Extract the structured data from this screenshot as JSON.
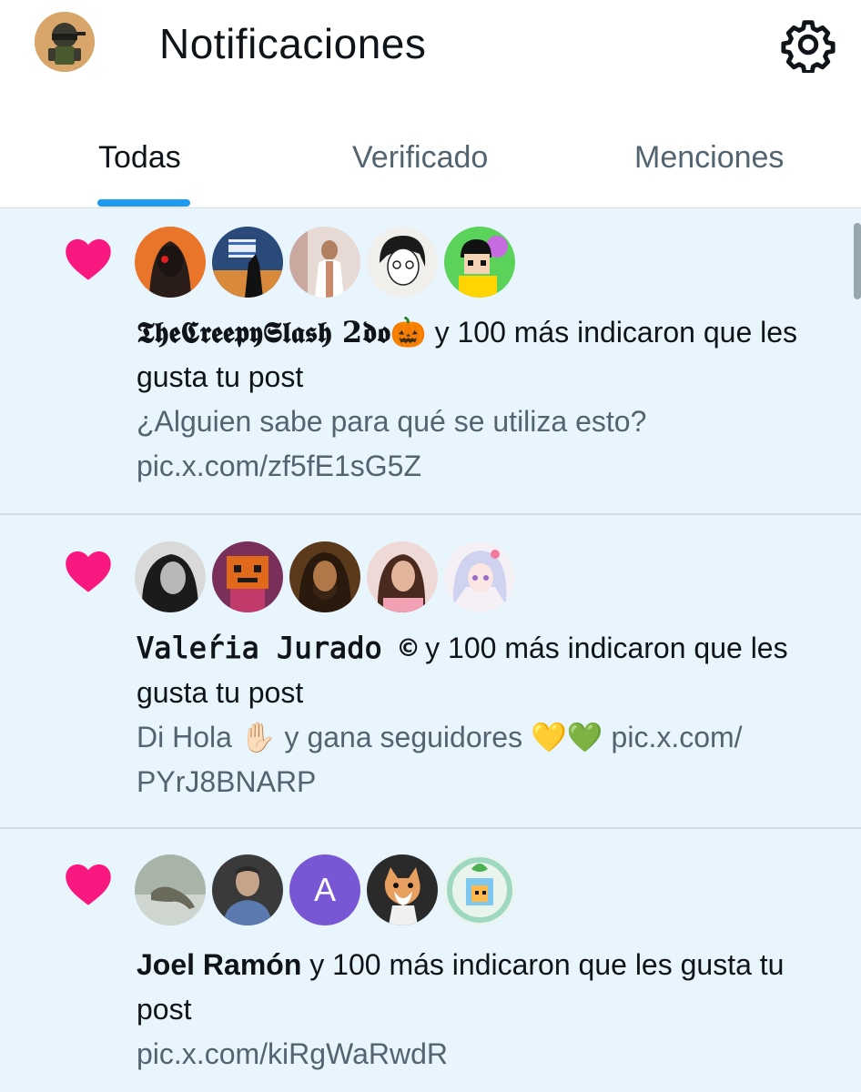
{
  "header": {
    "title": "Notificaciones"
  },
  "tabs": [
    {
      "label": "Todas",
      "active": true
    },
    {
      "label": "Verificado",
      "active": false
    },
    {
      "label": "Menciones",
      "active": false
    }
  ],
  "notifications": [
    {
      "type": "like",
      "user": "𝕿𝖍𝖊𝕮𝖗𝖊𝖊𝖕𝖞𝕾𝖑𝖆𝖘𝖍 𝟐𝖉𝖔🎃",
      "action": " y 100 más indicaron que les gusta tu post",
      "post_text": "¿Alguien sabe para qué se utiliza esto? pic.x.com/zf5fE1sG5Z"
    },
    {
      "type": "like",
      "user": "𝚅𝚊𝚕𝚎́𝚛𝚒𝚊 𝙹𝚞𝚛𝚊𝚍𝚘 ©",
      "action": " y 100 más indicaron que les gusta tu post",
      "post_text": "Di Hola ✋🏻 y gana seguidores 💛💚 pic.x.com/ PYrJ8BNARP"
    },
    {
      "type": "like",
      "user": "Joel Ramón",
      "action": " y 100 más indicaron que les gusta tu post",
      "post_text": "pic.x.com/kiRgWaRwdR",
      "avatar_letter": "A"
    }
  ],
  "colors": {
    "accent": "#1d9bf0",
    "heart": "#f91880",
    "feed_bg": "#e8f5fd",
    "secondary_text": "#536471"
  }
}
